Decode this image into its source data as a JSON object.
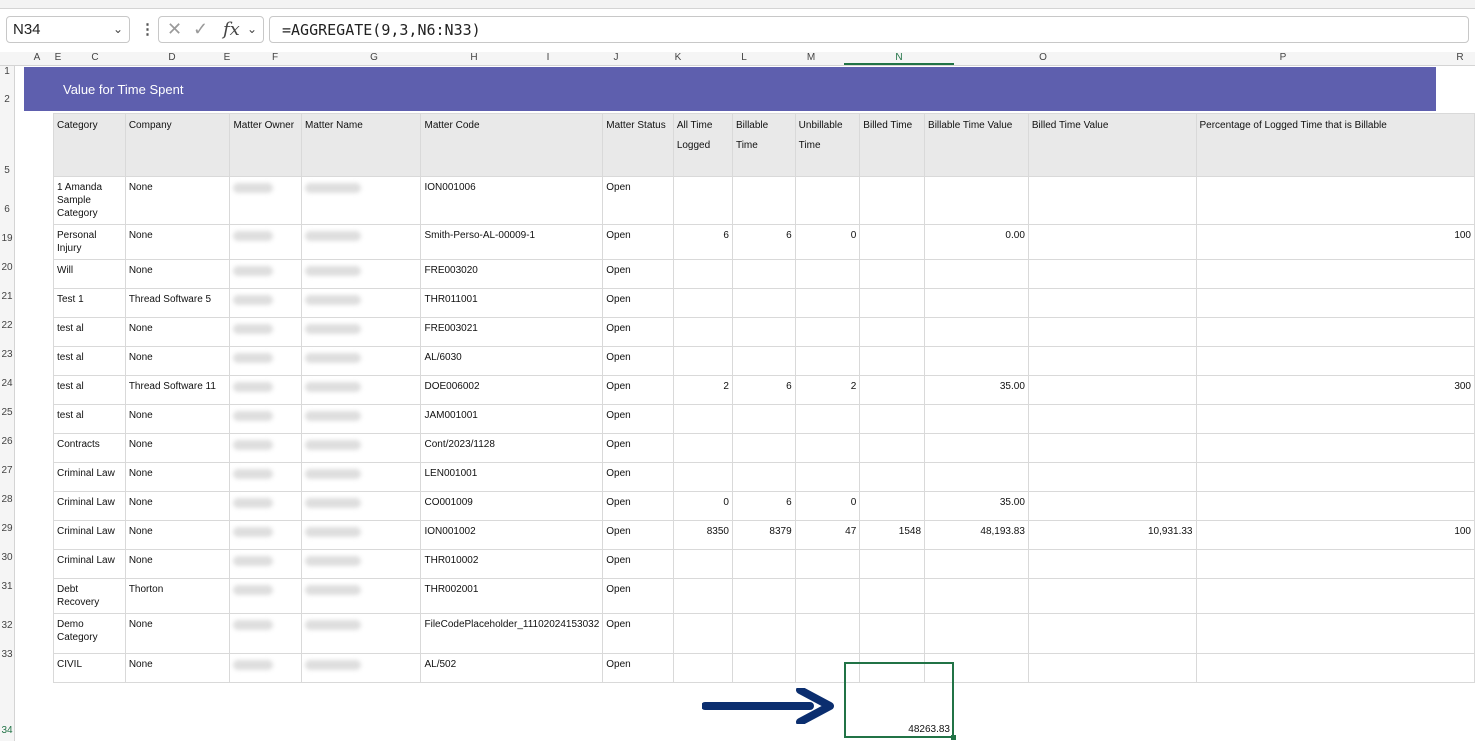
{
  "formula_bar": {
    "name_box": "N34",
    "formula": "=AGGREGATE(9,3,N6:N33)",
    "cancel_icon": "cancel-icon",
    "enter_icon": "check-icon",
    "fx_label": "fx"
  },
  "columns": [
    "A",
    "E",
    "C",
    "D",
    "E",
    "F",
    "G",
    "H",
    "I",
    "J",
    "K",
    "L",
    "M",
    "N",
    "O",
    "P",
    "R"
  ],
  "rows": [
    "1",
    "2",
    "5",
    "6",
    "19",
    "20",
    "21",
    "22",
    "23",
    "24",
    "25",
    "26",
    "27",
    "28",
    "29",
    "30",
    "31",
    "32",
    "33",
    "34"
  ],
  "banner_title": "Value for Time Spent",
  "headers": [
    "Category",
    "Company",
    "Matter Owner",
    "Matter Name",
    "Matter Code",
    "Matter Status",
    "All Time Logged",
    "Billable Time",
    "Unbillable Time",
    "Billed Time",
    "Billable Time Value",
    "Billed Time Value",
    "Percentage of Logged Time that is Billable"
  ],
  "data_rows": [
    {
      "category": "1 Amanda Sample Category",
      "company": "None",
      "code": "ION001006",
      "status": "Open",
      "all": "",
      "billable": "",
      "unbillable": "",
      "billed": "",
      "btv": "",
      "bdv": "",
      "pct": ""
    },
    {
      "category": "Personal Injury",
      "company": "None",
      "code": "Smith-Perso-AL-00009-1",
      "status": "Open",
      "all": "6",
      "billable": "6",
      "unbillable": "0",
      "billed": "",
      "btv": "0.00",
      "bdv": "",
      "pct": "100"
    },
    {
      "category": "Will",
      "company": "None",
      "code": "FRE003020",
      "status": "Open",
      "all": "",
      "billable": "",
      "unbillable": "",
      "billed": "",
      "btv": "",
      "bdv": "",
      "pct": ""
    },
    {
      "category": "Test 1",
      "company": "Thread Software 5",
      "code": "THR011001",
      "status": "Open",
      "all": "",
      "billable": "",
      "unbillable": "",
      "billed": "",
      "btv": "",
      "bdv": "",
      "pct": ""
    },
    {
      "category": "test al",
      "company": "None",
      "code": "FRE003021",
      "status": "Open",
      "all": "",
      "billable": "",
      "unbillable": "",
      "billed": "",
      "btv": "",
      "bdv": "",
      "pct": ""
    },
    {
      "category": "test al",
      "company": "None",
      "code": "AL/6030",
      "status": "Open",
      "all": "",
      "billable": "",
      "unbillable": "",
      "billed": "",
      "btv": "",
      "bdv": "",
      "pct": ""
    },
    {
      "category": "test al",
      "company": "Thread Software 11",
      "code": "DOE006002",
      "status": "Open",
      "all": "2",
      "billable": "6",
      "unbillable": "2",
      "billed": "",
      "btv": "35.00",
      "bdv": "",
      "pct": "300"
    },
    {
      "category": "test al",
      "company": "None",
      "code": "JAM001001",
      "status": "Open",
      "all": "",
      "billable": "",
      "unbillable": "",
      "billed": "",
      "btv": "",
      "bdv": "",
      "pct": ""
    },
    {
      "category": "Contracts",
      "company": "None",
      "code": "Cont/2023/1128",
      "status": "Open",
      "all": "",
      "billable": "",
      "unbillable": "",
      "billed": "",
      "btv": "",
      "bdv": "",
      "pct": ""
    },
    {
      "category": "Criminal Law",
      "company": "None",
      "code": "LEN001001",
      "status": "Open",
      "all": "",
      "billable": "",
      "unbillable": "",
      "billed": "",
      "btv": "",
      "bdv": "",
      "pct": ""
    },
    {
      "category": "Criminal Law",
      "company": "None",
      "code": "CO001009",
      "status": "Open",
      "all": "0",
      "billable": "6",
      "unbillable": "0",
      "billed": "",
      "btv": "35.00",
      "bdv": "",
      "pct": ""
    },
    {
      "category": "Criminal Law",
      "company": "None",
      "code": "ION001002",
      "status": "Open",
      "all": "8350",
      "billable": "8379",
      "unbillable": "47",
      "billed": "1548",
      "btv": "48,193.83",
      "bdv": "10,931.33",
      "pct": "100"
    },
    {
      "category": "Criminal Law",
      "company": "None",
      "code": "THR010002",
      "status": "Open",
      "all": "",
      "billable": "",
      "unbillable": "",
      "billed": "",
      "btv": "",
      "bdv": "",
      "pct": ""
    },
    {
      "category": "Debt Recovery",
      "company": "Thorton",
      "code": "THR002001",
      "status": "Open",
      "all": "",
      "billable": "",
      "unbillable": "",
      "billed": "",
      "btv": "",
      "bdv": "",
      "pct": ""
    },
    {
      "category": "Demo Category",
      "company": "None",
      "code": "FileCodePlaceholder_11102024153032",
      "status": "Open",
      "all": "",
      "billable": "",
      "unbillable": "",
      "billed": "",
      "btv": "",
      "bdv": "",
      "pct": ""
    },
    {
      "category": "CIVIL",
      "company": "None",
      "code": "AL/502",
      "status": "Open",
      "all": "",
      "billable": "",
      "unbillable": "",
      "billed": "",
      "btv": "",
      "bdv": "",
      "pct": ""
    }
  ],
  "selected_cell_value": "48263.83",
  "arrow_color": "#0b2e6f",
  "banner_color": "#5e5fae",
  "selection_color": "#217346"
}
